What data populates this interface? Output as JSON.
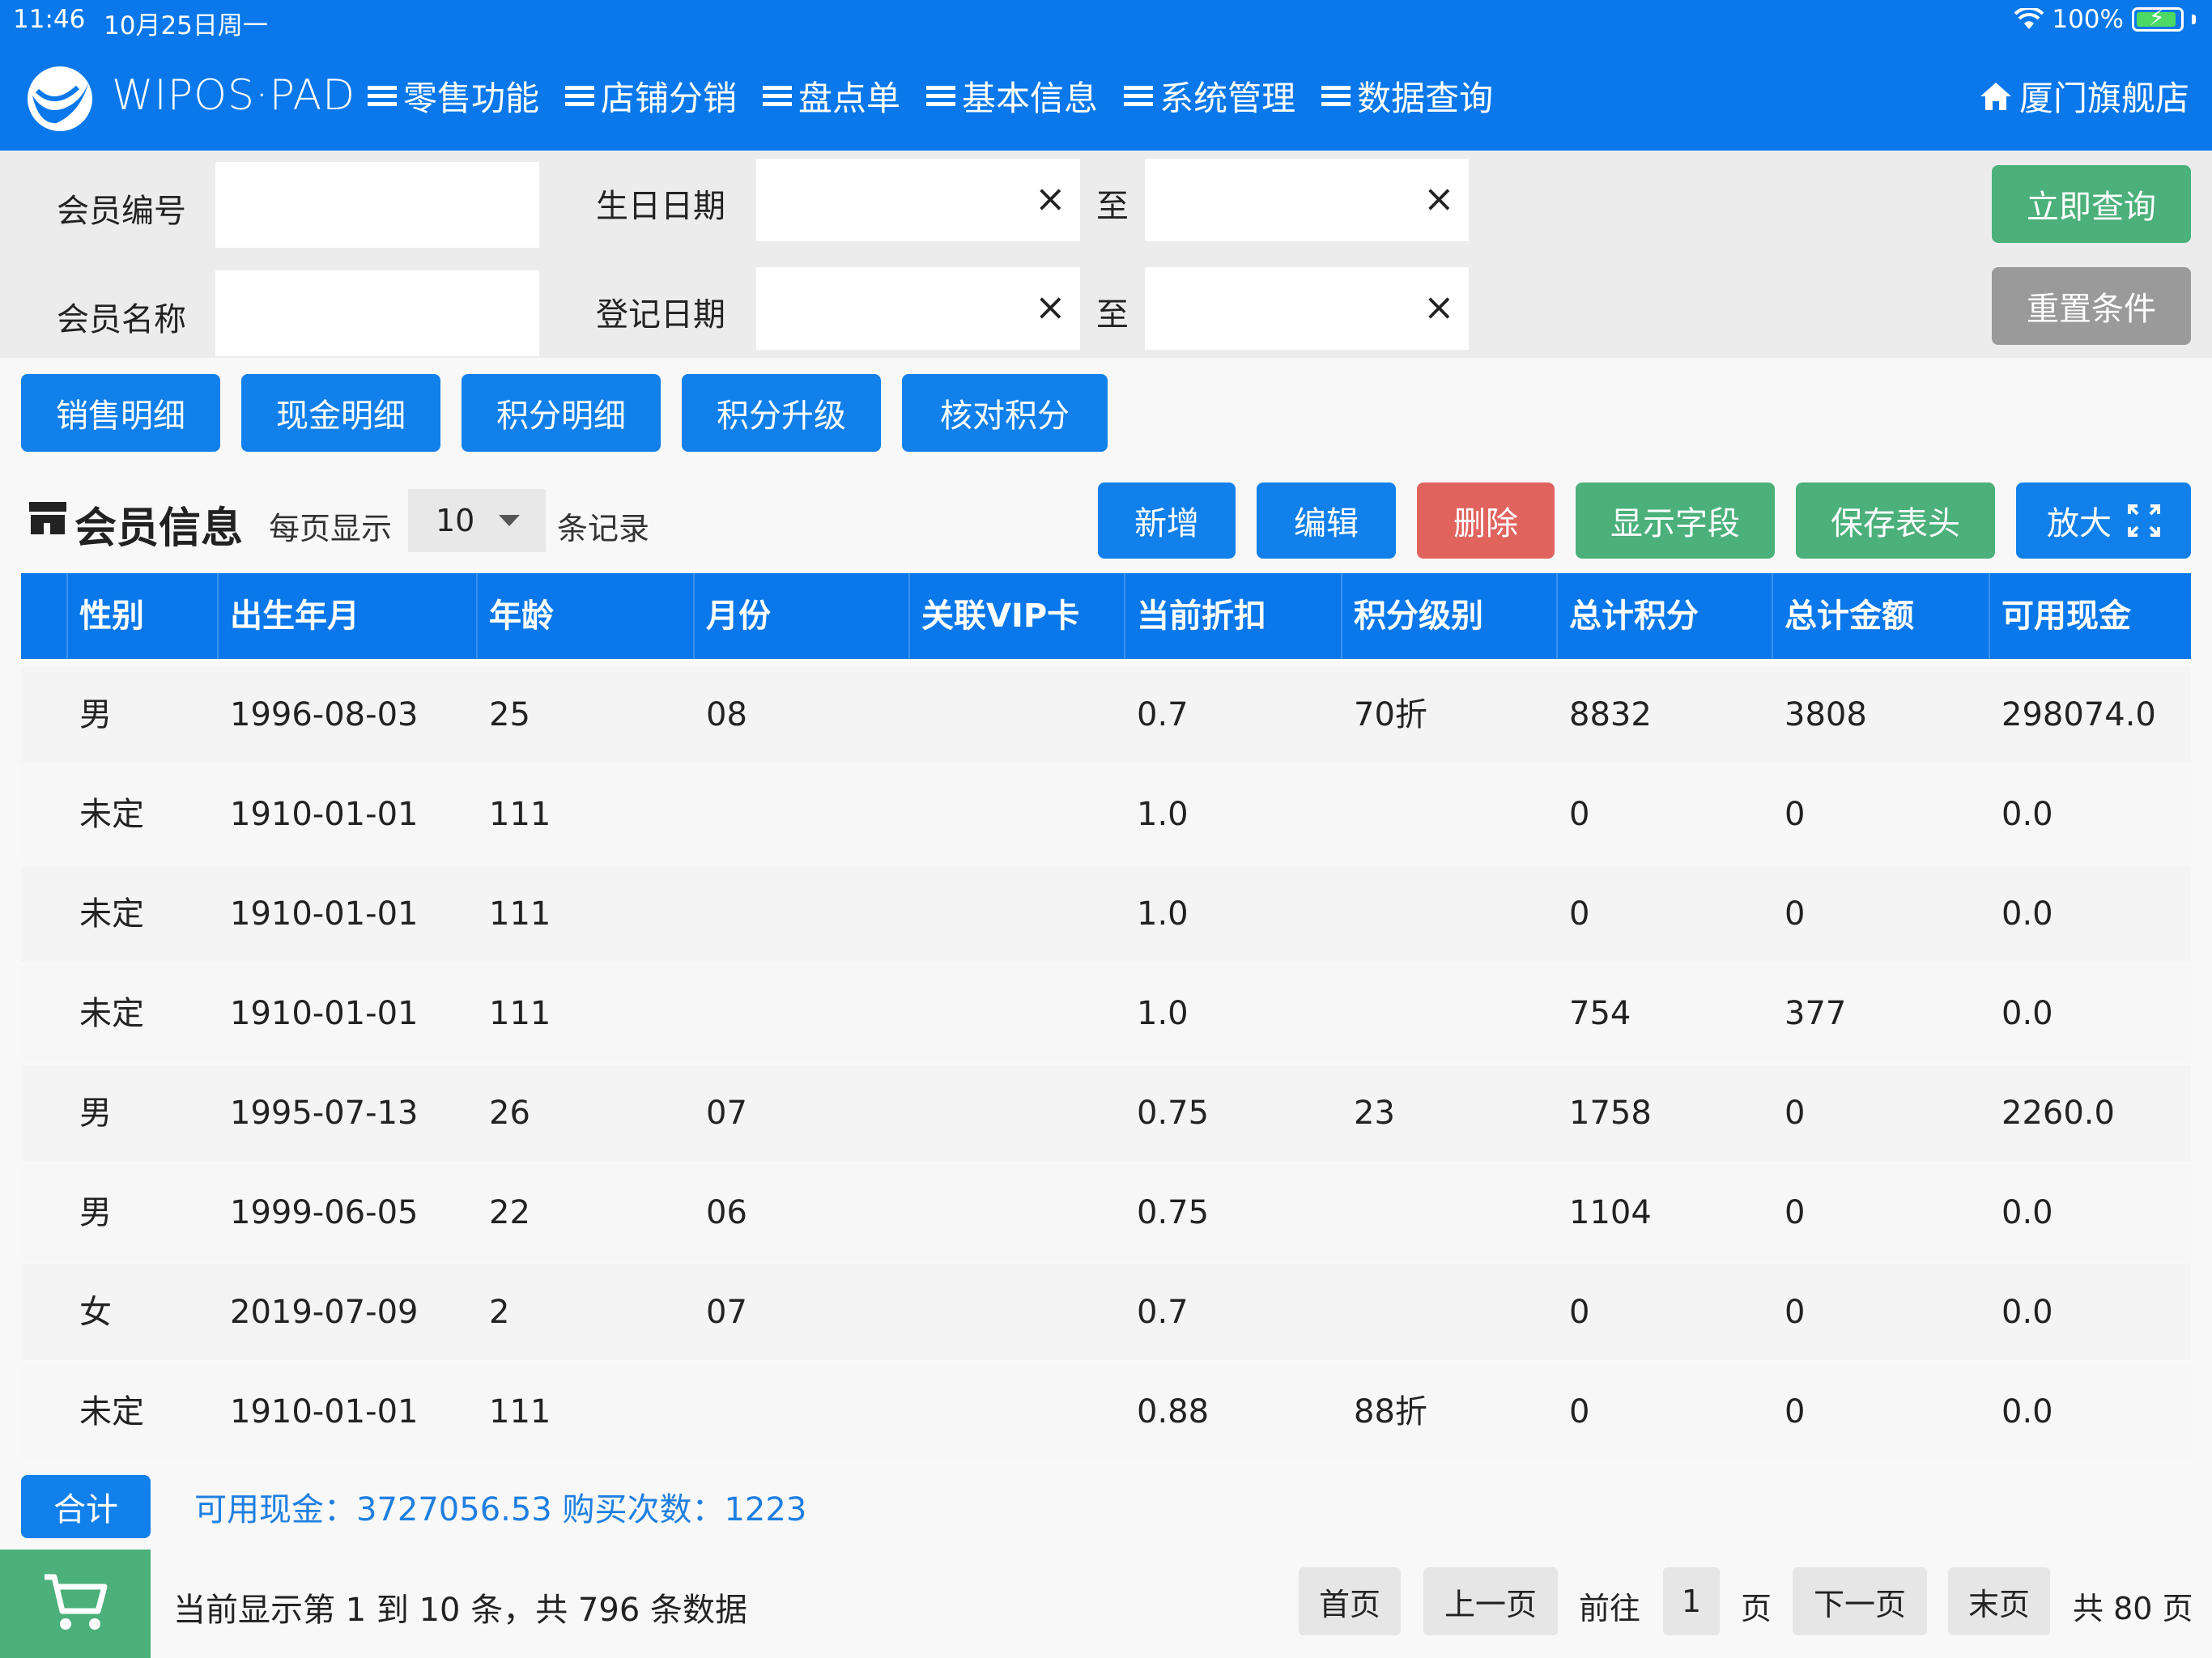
{
  "status_bar": {
    "time": "11:46",
    "date": "10月25日周一",
    "battery": "100%"
  },
  "header": {
    "brand": "WIPOS·PAD",
    "nav": [
      "零售功能",
      "店铺分销",
      "盘点单",
      "基本信息",
      "系统管理",
      "数据查询"
    ],
    "store": "厦门旗舰店"
  },
  "filters": {
    "member_no_label": "会员编号",
    "member_name_label": "会员名称",
    "birthday_label": "生日日期",
    "register_label": "登记日期",
    "to_label": "至",
    "clear_icon": "×",
    "query_button": "立即查询",
    "reset_button": "重置条件",
    "member_no_value": "",
    "member_name_value": "",
    "birthday_from": "",
    "birthday_to": "",
    "register_from": "",
    "register_to": ""
  },
  "detail_buttons": [
    "销售明细",
    "现金明细",
    "积分明细",
    "积分升级",
    "核对积分"
  ],
  "section": {
    "title": "会员信息",
    "per_page_label": "每页显示",
    "per_page_value": "10",
    "records_label": "条记录"
  },
  "actions": {
    "add": "新增",
    "edit": "编辑",
    "delete": "删除",
    "show_fields": "显示字段",
    "save_header": "保存表头",
    "enlarge": "放大"
  },
  "table": {
    "columns": [
      "性别",
      "出生年月",
      "年龄",
      "月份",
      "关联VIP卡",
      "当前折扣",
      "积分级别",
      "总计积分",
      "总计金额",
      "可用现金"
    ],
    "rows": [
      [
        "男",
        "1996-08-03",
        "25",
        "08",
        "",
        "0.7",
        "70折",
        "8832",
        "3808",
        "298074.0"
      ],
      [
        "未定",
        "1910-01-01",
        "111",
        "",
        "",
        "1.0",
        "",
        "0",
        "0",
        "0.0"
      ],
      [
        "未定",
        "1910-01-01",
        "111",
        "",
        "",
        "1.0",
        "",
        "0",
        "0",
        "0.0"
      ],
      [
        "未定",
        "1910-01-01",
        "111",
        "",
        "",
        "1.0",
        "",
        "754",
        "377",
        "0.0"
      ],
      [
        "男",
        "1995-07-13",
        "26",
        "07",
        "",
        "0.75",
        "23",
        "1758",
        "0",
        "2260.0"
      ],
      [
        "男",
        "1999-06-05",
        "22",
        "06",
        "",
        "0.75",
        "",
        "1104",
        "0",
        "0.0"
      ],
      [
        "女",
        "2019-07-09",
        "2",
        "07",
        "",
        "0.7",
        "",
        "0",
        "0",
        "0.0"
      ],
      [
        "未定",
        "1910-01-01",
        "111",
        "",
        "",
        "0.88",
        "88折",
        "0",
        "0",
        "0.0"
      ]
    ]
  },
  "summary": {
    "button": "合计",
    "text": "可用现金：3727056.53   购买次数：1223"
  },
  "pagination": {
    "info": "当前显示第 1 到 10 条，共 796 条数据",
    "first": "首页",
    "prev": "上一页",
    "goto": "前往",
    "page": "1",
    "page_unit": "页",
    "next": "下一页",
    "last": "末页",
    "total": "共 80 页"
  },
  "colors": {
    "primary": "#0a78ea",
    "green": "#4bb07a",
    "red": "#e0645d",
    "gray": "#9a9a9a",
    "summary_text": "#1f7fe0"
  }
}
